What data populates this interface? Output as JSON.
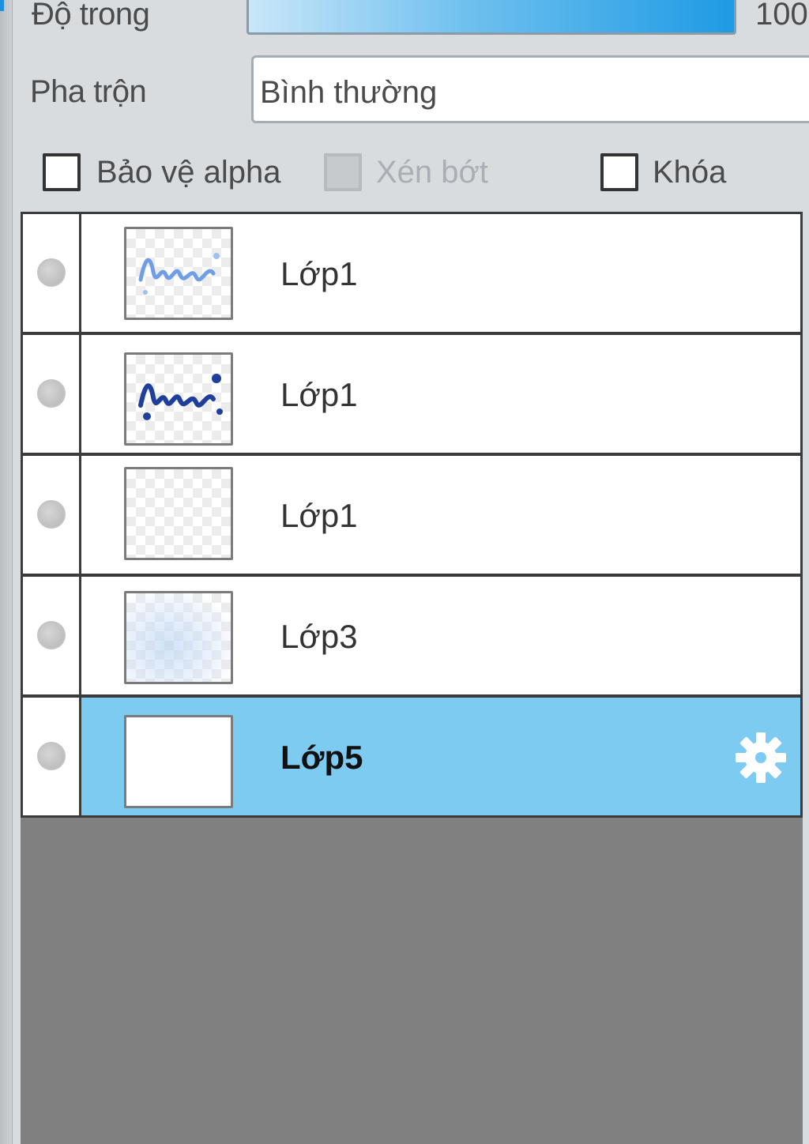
{
  "properties": {
    "opacity_label": "Độ trong",
    "opacity_value": "100",
    "opacity_level": 1.0,
    "blend_label": "Pha trộn",
    "blend_value": "Bình thường",
    "protect_alpha_label": "Bảo vệ alpha",
    "clipping_label": "Xén bớt",
    "lock_label": "Khóa"
  },
  "layers": [
    {
      "name": "Lớp1",
      "selected": false
    },
    {
      "name": "Lớp1",
      "selected": false
    },
    {
      "name": "Lớp1",
      "selected": false
    },
    {
      "name": "Lớp3",
      "selected": false
    },
    {
      "name": "Lớp5",
      "selected": true
    }
  ],
  "colors": {
    "selection": "#7ecbf2",
    "accent": "#1e9be4"
  },
  "icons": {
    "settings": "gear-icon",
    "visibility": "visibility-dot-icon"
  }
}
